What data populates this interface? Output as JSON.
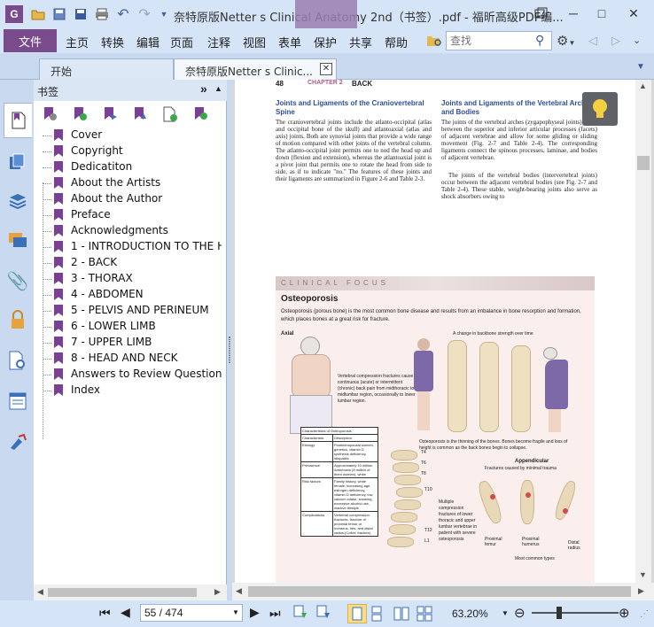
{
  "app": {
    "window_title": "奈特原版Netter s Clinical Anatomy 2nd（书签）.pdf - 福昕高级PDF编...",
    "quick_access": [
      "app-logo-icon",
      "open-icon",
      "save-icon",
      "save-as-icon",
      "print-icon",
      "undo-icon",
      "redo-icon",
      "dropdown-icon"
    ]
  },
  "menu": {
    "file": "文件",
    "items": [
      "主页",
      "转换",
      "编辑",
      "页面",
      "注释",
      "视图",
      "表单",
      "保护",
      "共享",
      "帮助"
    ],
    "search_placeholder": "查找"
  },
  "tabs": [
    {
      "label": "开始"
    },
    {
      "label": "奈特原版Netter s Clinic..."
    }
  ],
  "tab_close": "✕",
  "panel": {
    "title": "书签",
    "collapse": "»",
    "pin": "▲",
    "bookmarks": [
      "Cover",
      "Copyright",
      "Dedicatiton",
      "About the Artists",
      "About the Author",
      "Preface",
      "Acknowledgments",
      "1 - INTRODUCTION TO THE HU",
      "2 - BACK",
      "3 - THORAX",
      "4 - ABDOMEN",
      "5 - PELVIS AND PERINEUM",
      "6 - LOWER LIMB",
      "7 - UPPER LIMB",
      "8 - HEAD AND NECK",
      "Answers to Review Questions",
      "Index"
    ]
  },
  "page": {
    "page_num": "48",
    "chapter": "CHAPTER 2",
    "chapter_title": "BACK",
    "left_heading": "Joints and Ligaments of the Craniovertebral Spine",
    "left_body": "The craniovertebral joints include the atlanto-occipital (atlas and occipital bone of the skull) and atlantoaxial (atlas and axis) joints. Both are synovial joints that provide a wide range of motion compared with other joints of the vertebral column. The atlanto-occipital joint permits one to nod the head up and down (flexion and extension), whereas the atlantoaxial joint is a pivot joint that permits one to rotate the head from side to side, as if to indicate \"no.\" The features of these joints and their ligaments are summarized in Figure 2-6 and Table 2-3.",
    "right_heading": "Joints and Ligaments of the Vertebral Arches and Bodies",
    "right_body1": "The joints of the vertebral arches (zygapophyseal joints) occur between the superior and inferior articular processes (facets) of adjacent vertebrae and allow for some gliding or sliding movement (Fig. 2-7 and Table 2-4). The corresponding ligaments connect the spinous processes, laminae, and bodies of adjacent vertebrae.",
    "right_body2": "The joints of the vertebral bodies (intervertebral joints) occur between the adjacent vertebral bodies (see Fig. 2-7 and Table 2-4). These stable, weight-bearing joints also serve as shock absorbers owing to",
    "clinical_focus": "CLINICAL   FOCUS",
    "osteo_title": "Osteoporosis",
    "osteo_intro": "Osteoporosis (porous bone) is the most common bone disease and results from an imbalance in bone resorption and formation, which places bones at a great risk for fracture.",
    "axial": "Axial",
    "backbone_caption": "A change in backbone strength over time",
    "compression_text": "Vertebral compression fractures cause continuous (acute) or intermittent (chronic) back pain from midthoracic to midlumbar region, occasionally to lower lumbar region.",
    "thinning_text": "Osteoporosis is the thinning of the bones. Bones become fragile and loss of height is common as the back bones begin to collapse.",
    "table_title": "Characteristics of Osteoporosis",
    "table_headers": [
      "Characteristic",
      "Description"
    ],
    "table_rows": [
      [
        "Etiology",
        "Postmenopausal women, genetics, vitamin D synthesis deficiency, idiopathic"
      ],
      [
        "Prevalence",
        "Approximately 10 million Americans (8 million of them women), white"
      ],
      [
        "Risk factors",
        "Family history, white female, increasing age, estrogen deficiency, vitamin D deficiency, low calcium intake, smoking, excessive alcohol use, inactive lifestyle"
      ],
      [
        "Complications",
        "Vertebral compression fractures, fracture of proximal femur or humerus, ribs, and distal radius (Colles' fracture)"
      ]
    ],
    "spine_labels": [
      "T4",
      "T6",
      "T8",
      "T10",
      "T12",
      "L1"
    ],
    "multiple_text": "Multiple compression fractures of lower thoracic and upper lumbar vertebrae in patient with severe osteoporosis",
    "appendicular": "Appendicular",
    "appendicular_sub": "Fractures caused by minimal trauma",
    "fracture_labels": [
      "Proximal femur",
      "Proximal humerus",
      "Distal radius"
    ],
    "common_types": "Most common types"
  },
  "status": {
    "page_field": "55 / 474",
    "zoom": "63.20%"
  },
  "colors": {
    "accent": "#7a4b8c",
    "bookmark_flag": "#7b3f96",
    "heading_blue": "#2b4d9b",
    "clinical_band": "#e8d8d8"
  }
}
